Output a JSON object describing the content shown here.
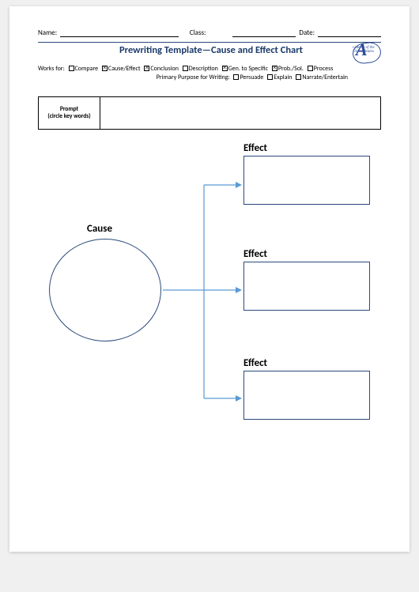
{
  "header": {
    "name_label": "Name:",
    "class_label": "Class:",
    "date_label": "Date:"
  },
  "title": "Prewriting Template—Cause and Effect Chart",
  "logo": {
    "letter": "A",
    "sub": "cademy\nof the\nUnited\nStates"
  },
  "works_for": {
    "lead": "Works for:",
    "items": [
      {
        "label": "Compare",
        "checked": false
      },
      {
        "label": "Cause/Effect",
        "checked": true
      },
      {
        "label": "Conclusion",
        "checked": true
      },
      {
        "label": "Description",
        "checked": false
      },
      {
        "label": "Gen. to Specific",
        "checked": true
      },
      {
        "label": "Prob./Sol.",
        "checked": true
      },
      {
        "label": "Process",
        "checked": false
      }
    ]
  },
  "purpose": {
    "lead": "Primary Purpose for Writing:",
    "items": [
      {
        "label": "Persuade",
        "checked": false
      },
      {
        "label": "Explain",
        "checked": false
      },
      {
        "label": "Narrate/Entertain",
        "checked": false
      }
    ]
  },
  "prompt": {
    "line1": "Prompt",
    "line2": "(circle key words)"
  },
  "diagram": {
    "cause_label": "Cause",
    "effects": [
      "Effect",
      "Effect",
      "Effect"
    ]
  }
}
